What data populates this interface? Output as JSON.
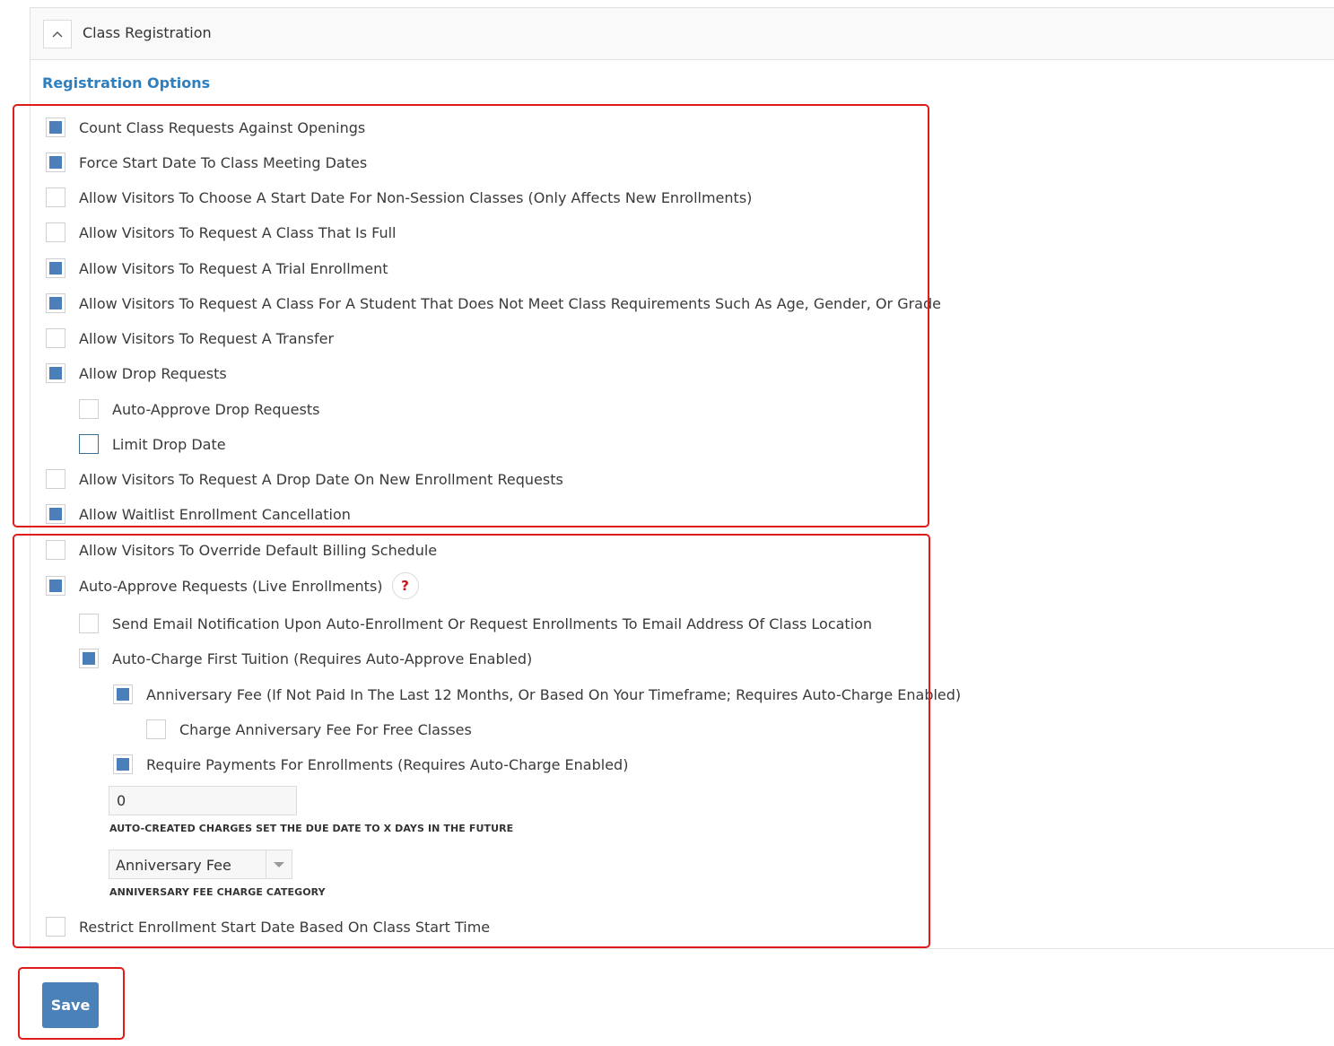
{
  "panel": {
    "title": "Class Registration",
    "collapse_icon": "chevron-up-icon"
  },
  "section": {
    "title": "Registration Options"
  },
  "options": {
    "count_requests": {
      "label": "Count Class Requests Against Openings",
      "checked": true
    },
    "force_start_date": {
      "label": "Force Start Date To Class Meeting Dates",
      "checked": true
    },
    "choose_start_date": {
      "label": "Allow Visitors To Choose A Start Date For Non-Session Classes (Only Affects New Enrollments)",
      "checked": false
    },
    "request_full_class": {
      "label": "Allow Visitors To Request A Class That Is Full",
      "checked": false
    },
    "request_trial": {
      "label": "Allow Visitors To Request A Trial Enrollment",
      "checked": true
    },
    "request_unqualified": {
      "label": "Allow Visitors To Request A Class For A Student That Does Not Meet Class Requirements Such As Age, Gender, Or Grade",
      "checked": true
    },
    "request_transfer": {
      "label": "Allow Visitors To Request A Transfer",
      "checked": false
    },
    "drop_requests": {
      "label": "Allow Drop Requests",
      "checked": true
    },
    "auto_approve_drop": {
      "label": "Auto-Approve Drop Requests",
      "checked": false
    },
    "limit_drop_date": {
      "label": "Limit Drop Date",
      "checked": false
    },
    "request_drop_date": {
      "label": "Allow Visitors To Request A Drop Date On New Enrollment Requests",
      "checked": false
    },
    "waitlist_cancellation": {
      "label": "Allow Waitlist Enrollment Cancellation",
      "checked": true
    },
    "override_billing": {
      "label": "Allow Visitors To Override Default Billing Schedule",
      "checked": false
    },
    "auto_approve": {
      "label": "Auto-Approve Requests (Live Enrollments)",
      "checked": true,
      "help_glyph": "?"
    },
    "email_notification": {
      "label": "Send Email Notification Upon Auto-Enrollment Or Request Enrollments To Email Address Of Class Location",
      "checked": false
    },
    "auto_charge": {
      "label": "Auto-Charge First Tuition (Requires Auto-Approve Enabled)",
      "checked": true
    },
    "anniversary_fee": {
      "label": "Anniversary Fee (If Not Paid In The Last 12 Months, Or Based On Your Timeframe; Requires Auto-Charge Enabled)",
      "checked": true
    },
    "anniversary_free": {
      "label": "Charge Anniversary Fee For Free Classes",
      "checked": false
    },
    "require_payments": {
      "label": "Require Payments For Enrollments (Requires Auto-Charge Enabled)",
      "checked": true
    },
    "restrict_start": {
      "label": "Restrict Enrollment Start Date Based On Class Start Time",
      "checked": false
    }
  },
  "due_days": {
    "value": "0",
    "caption": "AUTO-CREATED CHARGES SET THE DUE DATE TO X DAYS IN THE FUTURE"
  },
  "fee_category": {
    "selected": "Anniversary Fee",
    "caption": "ANNIVERSARY FEE CHARGE CATEGORY"
  },
  "save_label": "Save",
  "accent_colors": {
    "checkbox": "#4a7fb9",
    "section_title": "#2f7fbf",
    "highlight": "#e01b1b",
    "button": "#4a81b8"
  }
}
